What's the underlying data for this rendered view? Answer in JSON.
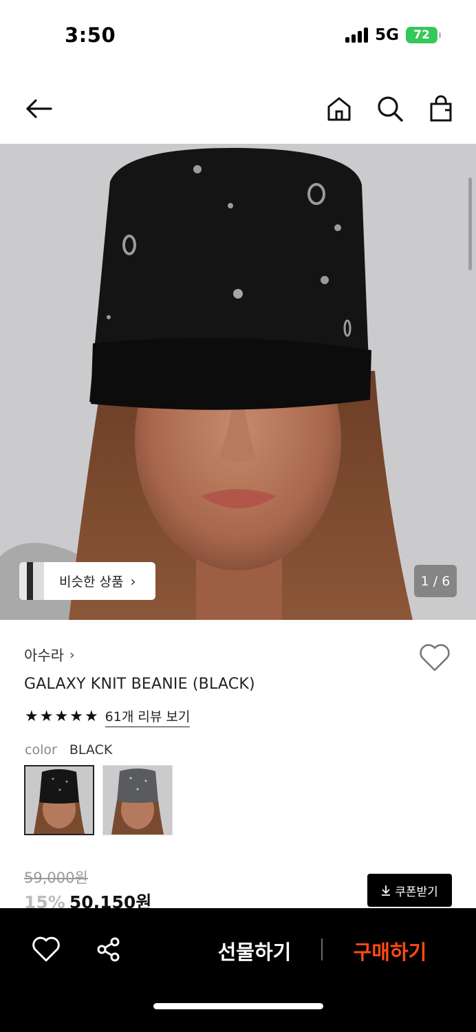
{
  "status_bar": {
    "time": "3:50",
    "network": "5G",
    "battery": "72"
  },
  "nav": {
    "back_icon": "arrow-left-icon",
    "home_icon": "home-icon",
    "search_icon": "search-icon",
    "bag_icon": "shopping-bag-icon"
  },
  "hero": {
    "similar_label": "비슷한 상품",
    "counter": "1 / 6"
  },
  "product": {
    "brand": "아수라",
    "title": "GALAXY KNIT BEANIE (BLACK)",
    "rating_stars": 5,
    "review_link": "61개 리뷰 보기",
    "color_label": "color",
    "color_value": "BLACK",
    "original_price": "59,000원",
    "discount": "15%",
    "sale_price": "50,150원",
    "coupon_label": "쿠폰받기"
  },
  "bottom_bar": {
    "gift_label": "선물하기",
    "buy_label": "구매하기"
  },
  "colors": {
    "accent": "#ff4b12",
    "battery": "#34c759"
  }
}
